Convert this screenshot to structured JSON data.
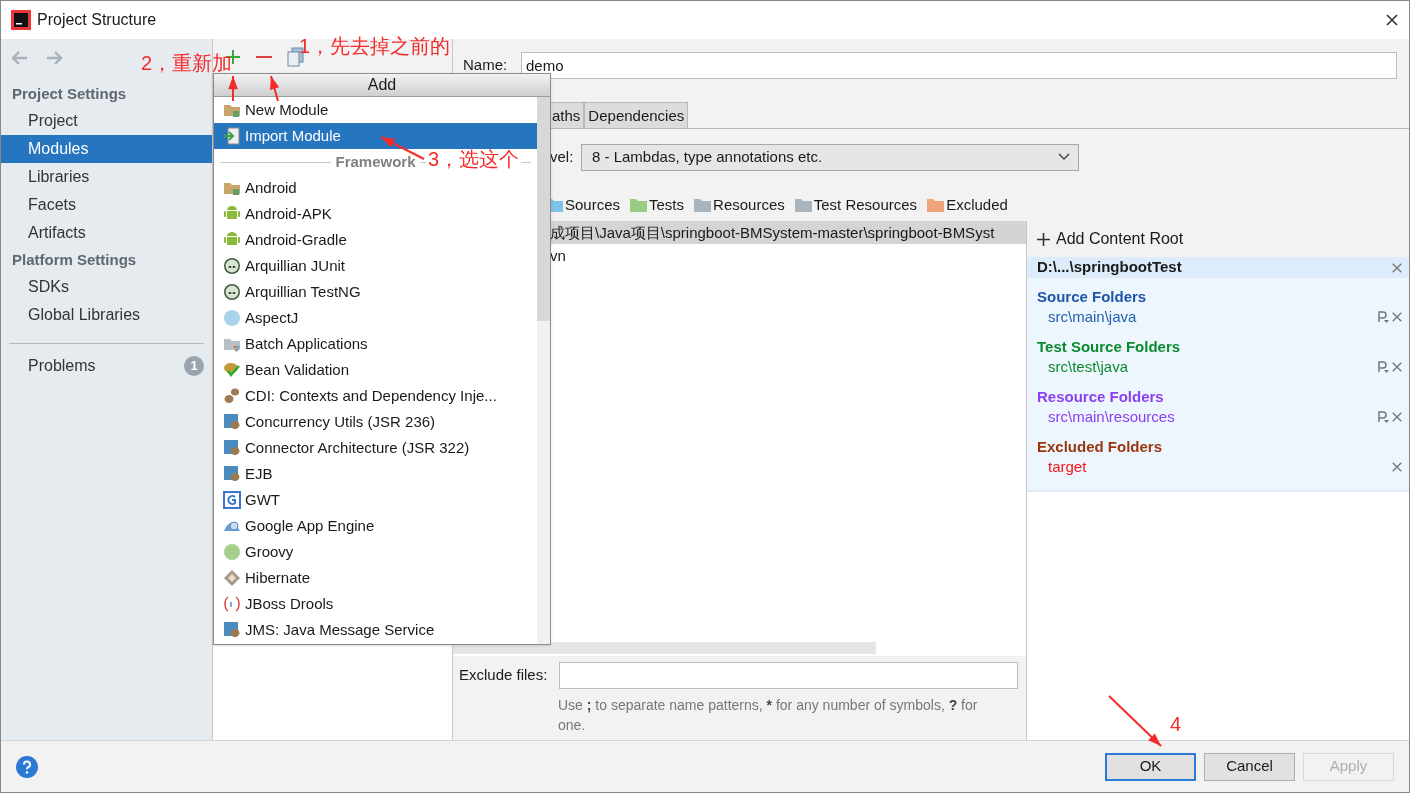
{
  "window": {
    "title": "Project Structure"
  },
  "annotations": [
    {
      "text": "1，先去掉之前的"
    },
    {
      "text": "2，重新加"
    },
    {
      "text": "3，选这个"
    },
    {
      "text": "4"
    }
  ],
  "sidebar": {
    "sections": [
      {
        "title": "Project Settings",
        "items": [
          {
            "label": "Project",
            "selected": false
          },
          {
            "label": "Modules",
            "selected": true
          },
          {
            "label": "Libraries",
            "selected": false
          },
          {
            "label": "Facets",
            "selected": false
          },
          {
            "label": "Artifacts",
            "selected": false
          }
        ]
      },
      {
        "title": "Platform Settings",
        "items": [
          {
            "label": "SDKs",
            "selected": false
          },
          {
            "label": "Global Libraries",
            "selected": false
          }
        ]
      }
    ],
    "problems": {
      "label": "Problems",
      "count": "1"
    }
  },
  "add_popup": {
    "title": "Add",
    "items": [
      {
        "label": "New Module",
        "selected": false
      },
      {
        "label": "Import Module",
        "selected": true
      }
    ],
    "separator": "Framework",
    "frameworks": [
      {
        "label": "Android"
      },
      {
        "label": "Android-APK"
      },
      {
        "label": "Android-Gradle"
      },
      {
        "label": "Arquillian JUnit"
      },
      {
        "label": "Arquillian TestNG"
      },
      {
        "label": "AspectJ"
      },
      {
        "label": "Batch Applications"
      },
      {
        "label": "Bean Validation"
      },
      {
        "label": "CDI: Contexts and Dependency Inje..."
      },
      {
        "label": "Concurrency Utils (JSR 236)"
      },
      {
        "label": "Connector Architecture (JSR 322)"
      },
      {
        "label": "EJB"
      },
      {
        "label": "GWT"
      },
      {
        "label": "Google App Engine"
      },
      {
        "label": "Groovy"
      },
      {
        "label": "Hibernate"
      },
      {
        "label": "JBoss Drools"
      },
      {
        "label": "JMS: Java Message Service"
      }
    ]
  },
  "module": {
    "name_label": "Name:",
    "name": "demo",
    "tabs": [
      {
        "label": "aths",
        "selected": false
      },
      {
        "label": "Dependencies",
        "selected": false
      }
    ],
    "language_level": {
      "label": "vel:",
      "value": "8 - Lambdas, type annotations etc."
    },
    "mark_as": [
      {
        "label": "Sources",
        "color": "#7ec3e8"
      },
      {
        "label": "Tests",
        "color": "#98cc82"
      },
      {
        "label": "Resources",
        "color": "#a9b4bd"
      },
      {
        "label": "Test Resources",
        "color": "#a9b4bd"
      },
      {
        "label": "Excluded",
        "color": "#f0a47a"
      }
    ],
    "tree": [
      {
        "label": "成项目\\Java项目\\springboot-BMSystem-master\\springboot-BMSyst",
        "selected": true
      },
      {
        "label": "vn",
        "selected": false
      }
    ],
    "content_root": {
      "add_label": "Add Content Root",
      "path": "D:\\...\\springbootTest",
      "groups": [
        {
          "title": "Source Folders",
          "color": "#1d56a8",
          "folders": [
            {
              "path": "src\\main\\java",
              "has_prefix": true,
              "color": "#2460b0"
            }
          ]
        },
        {
          "title": "Test Source Folders",
          "color": "#0b8a2e",
          "folders": [
            {
              "path": "src\\test\\java",
              "has_prefix": true,
              "color": "#0b8a2e"
            }
          ]
        },
        {
          "title": "Resource Folders",
          "color": "#8a3ff2",
          "folders": [
            {
              "path": "src\\main\\resources",
              "has_prefix": true,
              "color": "#8a3ff2"
            }
          ]
        },
        {
          "title": "Excluded Folders",
          "color": "#9a3510",
          "folders": [
            {
              "path": "target",
              "has_prefix": false,
              "color": "#f21818"
            }
          ]
        }
      ]
    },
    "exclude": {
      "label": "Exclude files:",
      "hint": [
        {
          "text": "Use ",
          "bold": false
        },
        {
          "text": ";",
          "bold": true
        },
        {
          "text": " to separate name patterns, ",
          "bold": false
        },
        {
          "text": "*",
          "bold": true
        },
        {
          "text": " for any number of symbols, ",
          "bold": false
        },
        {
          "text": "?",
          "bold": true
        },
        {
          "text": " for one.",
          "bold": false
        }
      ]
    }
  },
  "buttons": [
    {
      "label": "OK",
      "kind": "default",
      "disabled": false
    },
    {
      "label": "Cancel",
      "kind": "normal",
      "disabled": false
    },
    {
      "label": "Apply",
      "kind": "normal",
      "disabled": true
    }
  ]
}
